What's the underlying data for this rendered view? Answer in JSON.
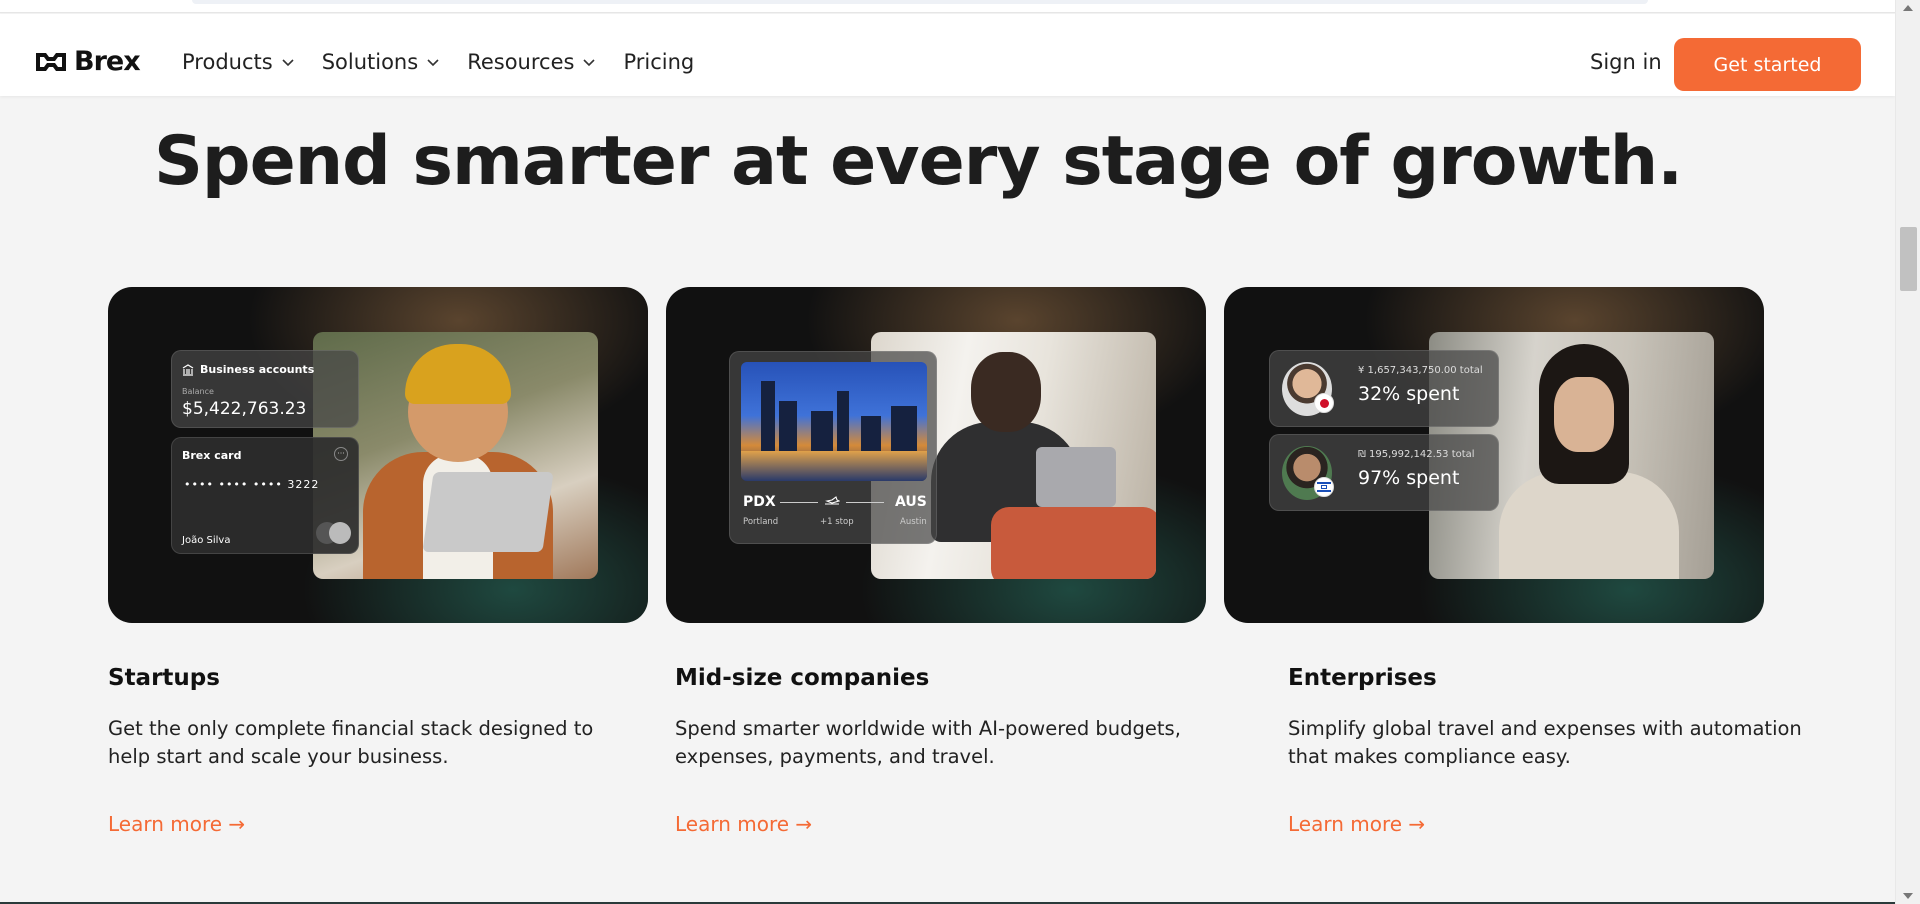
{
  "nav": {
    "logo_text": "Brex",
    "menu": [
      {
        "label": "Products",
        "has_dropdown": true
      },
      {
        "label": "Solutions",
        "has_dropdown": true
      },
      {
        "label": "Resources",
        "has_dropdown": true
      },
      {
        "label": "Pricing",
        "has_dropdown": false
      }
    ],
    "sign_in": "Sign in",
    "cta": "Get started"
  },
  "headline": "Spend smarter at every stage of growth.",
  "cards": [
    {
      "visual": {
        "accounts_title": "Business accounts",
        "balance_label": "Balance",
        "balance_value": "$5,422,763.23",
        "card_title": "Brex card",
        "card_number": "•••• •••• •••• 3222",
        "card_holder": "João Silva",
        "card_brand": "mastercard"
      },
      "title": "Startups",
      "description": "Get the only complete financial stack designed to help start and scale your business.",
      "link": "Learn more →"
    },
    {
      "visual": {
        "from_code": "PDX",
        "from_city": "Portland",
        "stops": "+1 stop",
        "to_code": "AUS",
        "to_city": "Austin"
      },
      "title": "Mid-size companies",
      "description": "Spend smarter worldwide with AI-powered budgets, expenses, payments, and travel.",
      "link": "Learn more →"
    },
    {
      "visual": {
        "rows": [
          {
            "total": "¥ 1,657,343,750.00 total",
            "spent": "32% spent"
          },
          {
            "total": "₪ 195,992,142.53 total",
            "spent": "97% spent"
          }
        ]
      },
      "title": "Enterprises",
      "description": "Simplify global travel and expenses with automation that makes compliance easy.",
      "link": "Learn more →"
    }
  ],
  "colors": {
    "accent": "#f46a35",
    "background": "#f4f4f4",
    "card_bg": "#111111"
  }
}
